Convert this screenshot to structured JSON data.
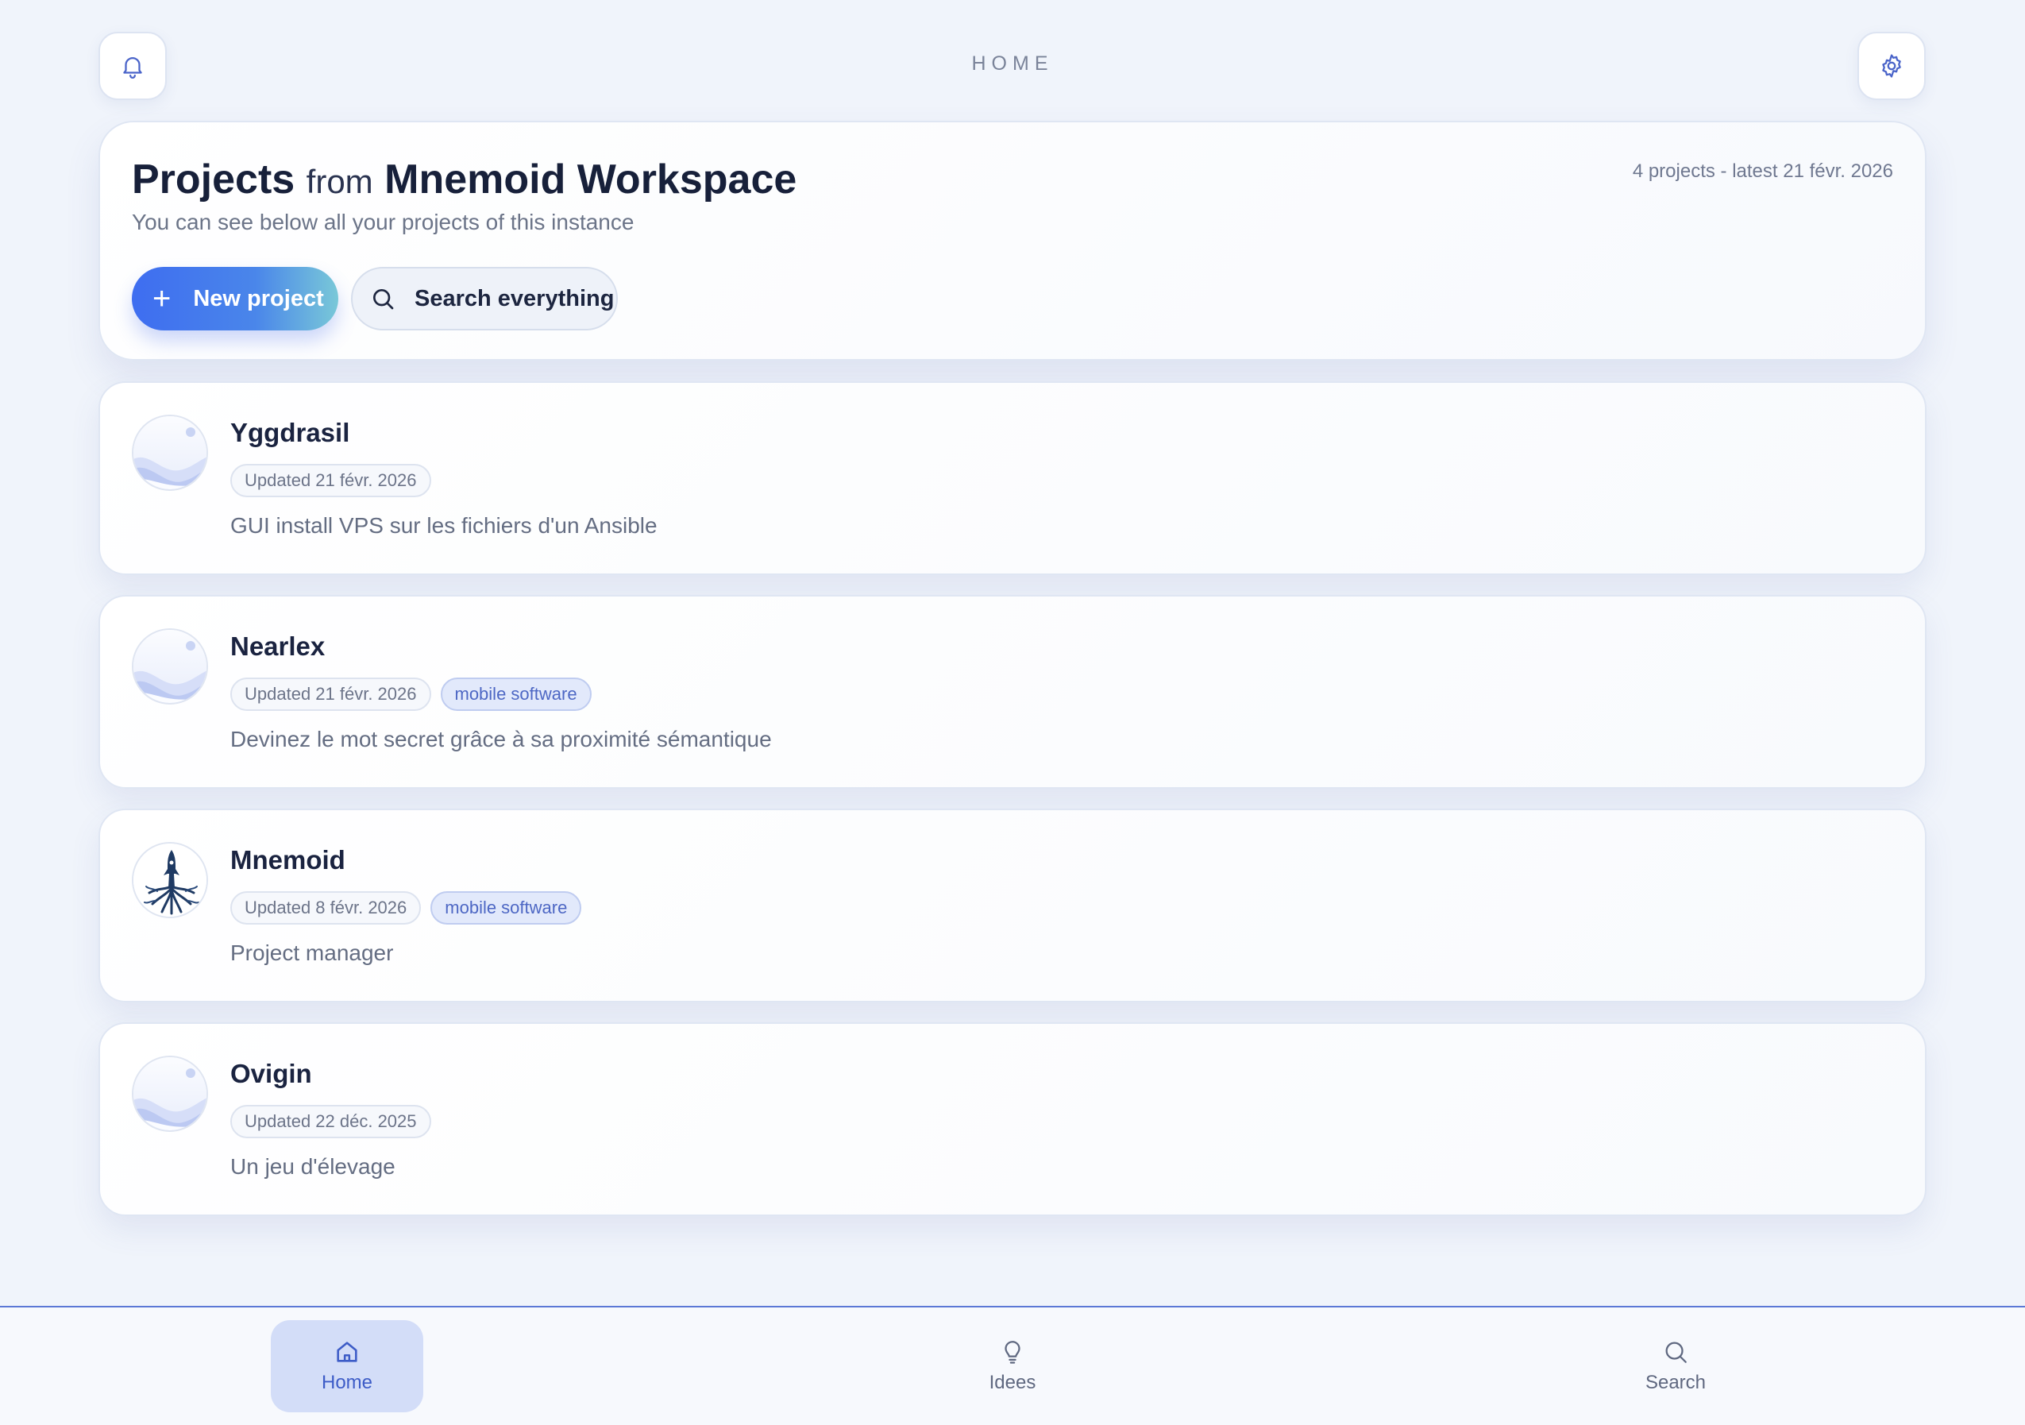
{
  "topbar": {
    "title": "HOME",
    "notifications_icon": "bell-icon",
    "settings_icon": "gear-icon"
  },
  "header": {
    "title_strong": "Projects",
    "title_from": "from",
    "title_workspace": "Mnemoid Workspace",
    "subtitle": "You can see below all your projects of this instance",
    "meta": "4 projects - latest 21 févr. 2026",
    "new_project_label": "New project",
    "search_label": "Search everything"
  },
  "projects": [
    {
      "name": "Yggdrasil",
      "updated": "Updated 21 févr. 2026",
      "tag": "",
      "description": "GUI install VPS sur les fichiers d'un Ansible",
      "avatar_icon": "placeholder-wave-icon"
    },
    {
      "name": "Nearlex",
      "updated": "Updated 21 févr. 2026",
      "tag": "mobile software",
      "description": "Devinez le mot secret grâce à sa proximité sémantique",
      "avatar_icon": "placeholder-wave-icon"
    },
    {
      "name": "Mnemoid",
      "updated": "Updated 8 févr. 2026",
      "tag": "mobile software",
      "description": "Project manager",
      "avatar_icon": "rocket-tree-logo-icon"
    },
    {
      "name": "Ovigin",
      "updated": "Updated 22 déc. 2025",
      "tag": "",
      "description": "Un jeu d'élevage",
      "avatar_icon": "placeholder-wave-icon"
    }
  ],
  "bottom_nav": {
    "items": [
      {
        "label": "Home",
        "icon": "home-icon",
        "active": true
      },
      {
        "label": "Idees",
        "icon": "lightbulb-icon",
        "active": false
      },
      {
        "label": "Search",
        "icon": "search-icon",
        "active": false
      }
    ]
  },
  "colors": {
    "background": "#f0f4fb",
    "accent": "#3e6df0",
    "accent_gradient_end": "#79c8d8",
    "nav_active_bg": "#d3ddf8",
    "tag_text": "#4d67c4"
  }
}
